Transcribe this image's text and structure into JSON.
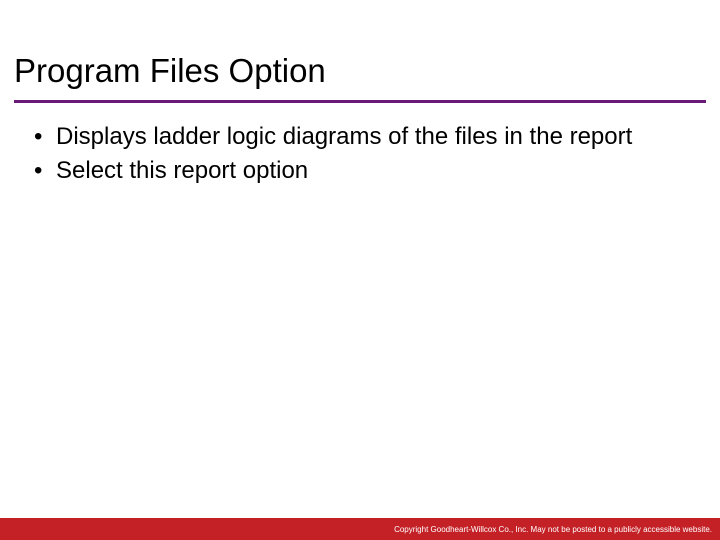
{
  "slide": {
    "title": "Program Files Option",
    "bullets": [
      "Displays ladder logic diagrams of the files in the report",
      "Select this report option"
    ],
    "footer": "Copyright Goodheart-Willcox Co., Inc.  May not be posted to a publicly accessible website."
  },
  "colors": {
    "accent": "#6a1b7a",
    "footer_bg": "#c42127"
  }
}
